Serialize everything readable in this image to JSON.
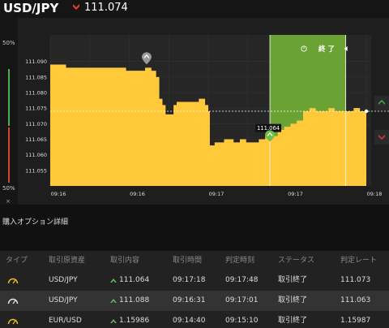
{
  "header": {
    "pair": "USD/JPY",
    "price": "111.074",
    "direction_icon": "down-arrow-icon",
    "down_color": "#e0412a"
  },
  "gauge": {
    "top_label": "50%",
    "bottom_label": "50%",
    "close_label": "×",
    "up_color": "#4caf50",
    "down_color": "#d0452b"
  },
  "chart_data": {
    "type": "area",
    "title": "",
    "xlabel": "",
    "ylabel": "",
    "ylim": [
      111.05,
      111.098
    ],
    "y_ticks": [
      "111.085",
      "111.080",
      "111.075",
      "111.070",
      "111.065",
      "111.060",
      "111.055",
      "111.090"
    ],
    "y_tick_values": [
      111.085,
      111.08,
      111.075,
      111.07,
      111.065,
      111.06,
      111.055,
      111.09
    ],
    "x_ticks": [
      "09:16",
      "09:16",
      "09:17",
      "09:17",
      "09:18"
    ],
    "x_tick_fractions": [
      0.0,
      0.25,
      0.5,
      0.75,
      1.0
    ],
    "series": [
      {
        "values_x": [
          0.0,
          0.04,
          0.05,
          0.1,
          0.15,
          0.2,
          0.24,
          0.27,
          0.3,
          0.32,
          0.335,
          0.345,
          0.355,
          0.365,
          0.39,
          0.4,
          0.44,
          0.47,
          0.49,
          0.5,
          0.505,
          0.52,
          0.55,
          0.58,
          0.6,
          0.62,
          0.66,
          0.68,
          0.7,
          0.72,
          0.74,
          0.76,
          0.78,
          0.8,
          0.82,
          0.84,
          0.86,
          0.88,
          0.9,
          0.92,
          0.94,
          0.96,
          0.98,
          1.0
        ],
        "values_y": [
          111.089,
          111.089,
          111.088,
          111.088,
          111.088,
          111.088,
          111.087,
          111.087,
          111.088,
          111.087,
          111.085,
          111.078,
          111.076,
          111.073,
          111.076,
          111.077,
          111.077,
          111.078,
          111.076,
          111.074,
          111.063,
          111.064,
          111.065,
          111.064,
          111.065,
          111.064,
          111.065,
          111.066,
          111.066,
          111.068,
          111.069,
          111.07,
          111.071,
          111.074,
          111.075,
          111.074,
          111.074,
          111.075,
          111.074,
          111.074,
          111.074,
          111.075,
          111.074,
          111.074
        ]
      }
    ],
    "current_price": 111.074,
    "entry_price": "111.064",
    "entry_marker_icon": "up-arrow-marker-icon",
    "past_marker_icon": "down-arrow-marker-icon",
    "expiry_label": "終 了",
    "expiry_icon": "clock-icon",
    "area_color": "#ffc93a",
    "expiry_zone_color": "#6aa334",
    "grid": true
  },
  "side_buttons": {
    "up_icon": "up-arrow-icon",
    "down_icon": "down-arrow-icon"
  },
  "section": {
    "title": "購入オプション詳細"
  },
  "table": {
    "headers": [
      "タイプ",
      "取引原資産",
      "取引内容",
      "取引時間",
      "判定時刻",
      "ステータス",
      "判定レート"
    ],
    "rows": [
      {
        "type_icon": "gauge-icon",
        "asset": "USD/JPY",
        "direction_icon": "up-arrow-icon",
        "rate": "111.064",
        "trade_time": "09:17:18",
        "judge_time": "09:17:48",
        "status": "取引終了",
        "judge_rate": "111.073"
      },
      {
        "type_icon": "gauge-icon",
        "asset": "USD/JPY",
        "direction_icon": "up-arrow-icon",
        "rate": "111.088",
        "trade_time": "09:16:31",
        "judge_time": "09:17:01",
        "status": "取引終了",
        "judge_rate": "111.063"
      },
      {
        "type_icon": "gauge-icon",
        "asset": "EUR/USD",
        "direction_icon": "up-arrow-icon",
        "rate": "1.15986",
        "trade_time": "09:14:40",
        "judge_time": "09:15:10",
        "status": "取引終了",
        "judge_rate": "1.15987"
      }
    ]
  }
}
